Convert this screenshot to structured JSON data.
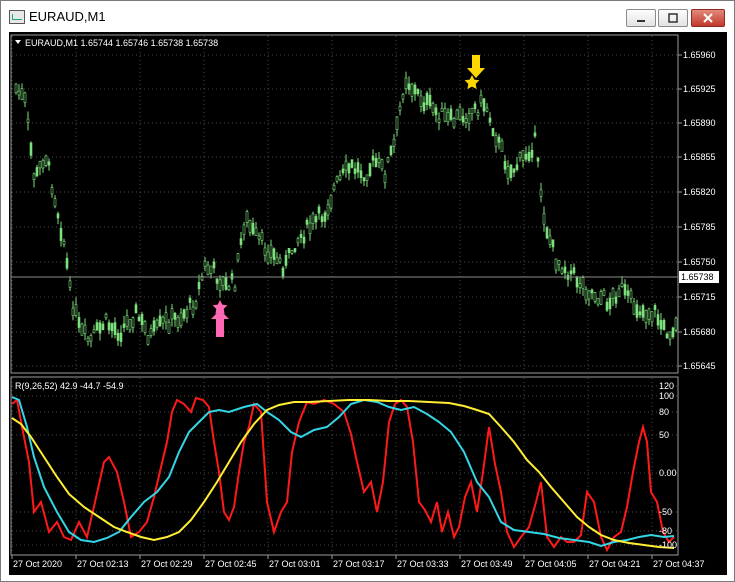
{
  "window": {
    "title": "EURAUD,M1",
    "minimize_icon": "minimize-icon",
    "maximize_icon": "maximize-icon",
    "close_icon": "close-icon"
  },
  "main_chart": {
    "info": "EURAUD,M1  1.65744 1.65746 1.65738 1.65738",
    "price_labels": [
      "1.65960",
      "1.65925",
      "1.65890",
      "1.65855",
      "1.65820",
      "1.65785",
      "1.65750",
      "1.65715",
      "1.65680",
      "1.65645"
    ],
    "current_price": "1.65738",
    "candle_color": "#7de07d",
    "up_arrow_color": "#ff69b4",
    "down_arrow_color": "#ffd700"
  },
  "indicator": {
    "info": "R(9,26,52) 42.9 -44.7 -54.9",
    "levels": [
      "120",
      "100",
      "80",
      "50",
      "0.00",
      "-50",
      "-80",
      "-100"
    ],
    "series_colors": [
      "#ff1a1a",
      "#33d6e6",
      "#ffee33"
    ]
  },
  "time_axis": {
    "labels": [
      "27 Oct 2020",
      "27 Oct 02:13",
      "27 Oct 02:29",
      "27 Oct 02:45",
      "27 Oct 03:01",
      "27 Oct 03:17",
      "27 Oct 03:33",
      "27 Oct 03:49",
      "27 Oct 04:05",
      "27 Oct 04:21",
      "27 Oct 04:37"
    ]
  }
}
